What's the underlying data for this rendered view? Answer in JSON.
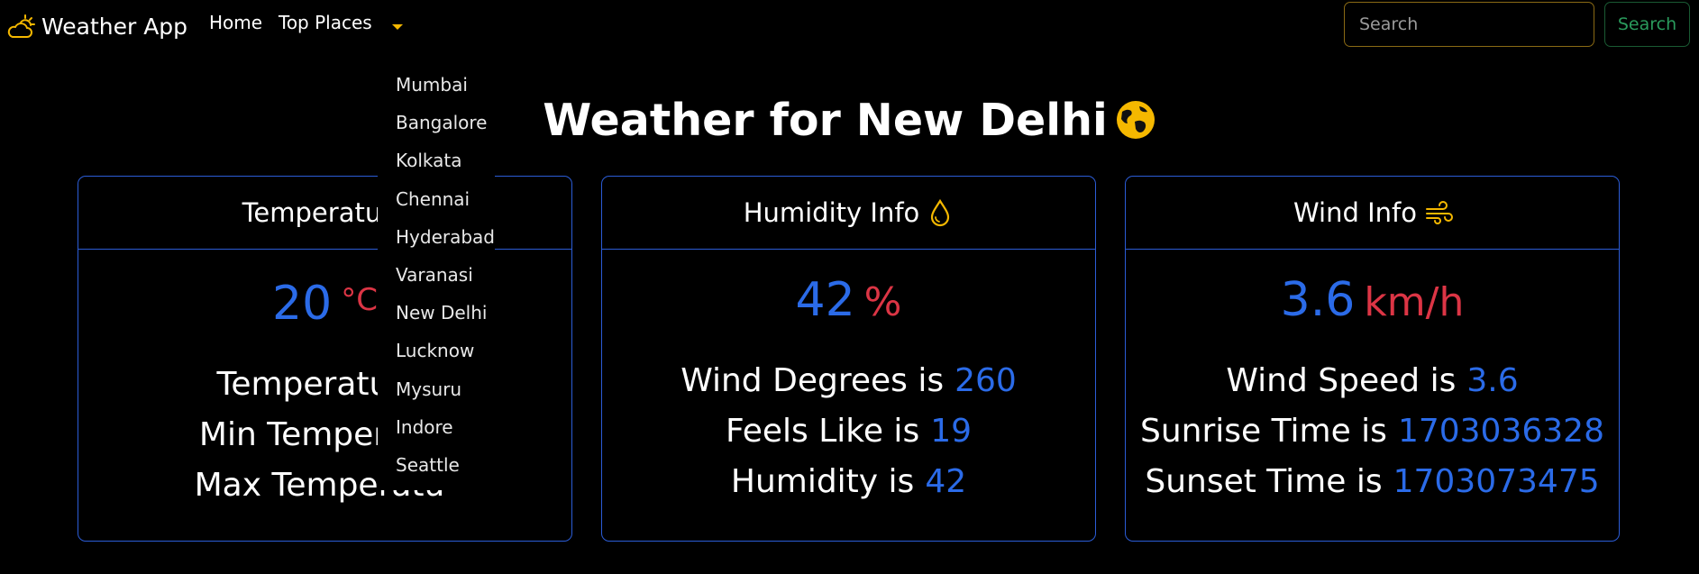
{
  "navbar": {
    "brand": "Weather App",
    "home_label": "Home",
    "top_places_label": "Top Places",
    "search_placeholder": "Search",
    "search_button_label": "Search"
  },
  "dropdown": {
    "items": [
      "Mumbai",
      "Bangalore",
      "Kolkata",
      "Chennai",
      "Hyderabad",
      "Varanasi",
      "New Delhi",
      "Lucknow",
      "Mysuru",
      "Indore",
      "Seattle"
    ]
  },
  "title": "Weather for New Delhi",
  "cards": {
    "temperature": {
      "header": "Temperature",
      "value": "20",
      "unit": "°C",
      "lines": [
        {
          "label": "Temperature",
          "value": ""
        },
        {
          "label": "Min Temperatu",
          "value": ""
        },
        {
          "label": "Max Temperatu",
          "value": ""
        }
      ]
    },
    "humidity": {
      "header": "Humidity Info",
      "value": "42",
      "unit": "%",
      "lines": [
        {
          "label": "Wind Degrees is",
          "value": "260"
        },
        {
          "label": "Feels Like is",
          "value": "19"
        },
        {
          "label": "Humidity is",
          "value": "42"
        }
      ]
    },
    "wind": {
      "header": "Wind Info",
      "value": "3.6",
      "unit": "km/h",
      "lines": [
        {
          "label": "Wind Speed is",
          "value": "3.6"
        },
        {
          "label": "Sunrise Time is",
          "value": "1703036328"
        },
        {
          "label": "Sunset Time is",
          "value": "1703073475"
        }
      ]
    }
  },
  "colors": {
    "accent_blue": "#2b6be8",
    "unit_red": "#dc3545",
    "icon_yellow": "#f5b800",
    "border_blue": "#2b5cd6",
    "search_border": "#8a6a14",
    "search_button_green": "#2a9b5c"
  },
  "icons": {
    "brand": "cloud-sun-icon",
    "caret": "caret-down-icon",
    "title": "globe-icon",
    "humidity": "droplet-icon",
    "wind": "wind-icon"
  }
}
